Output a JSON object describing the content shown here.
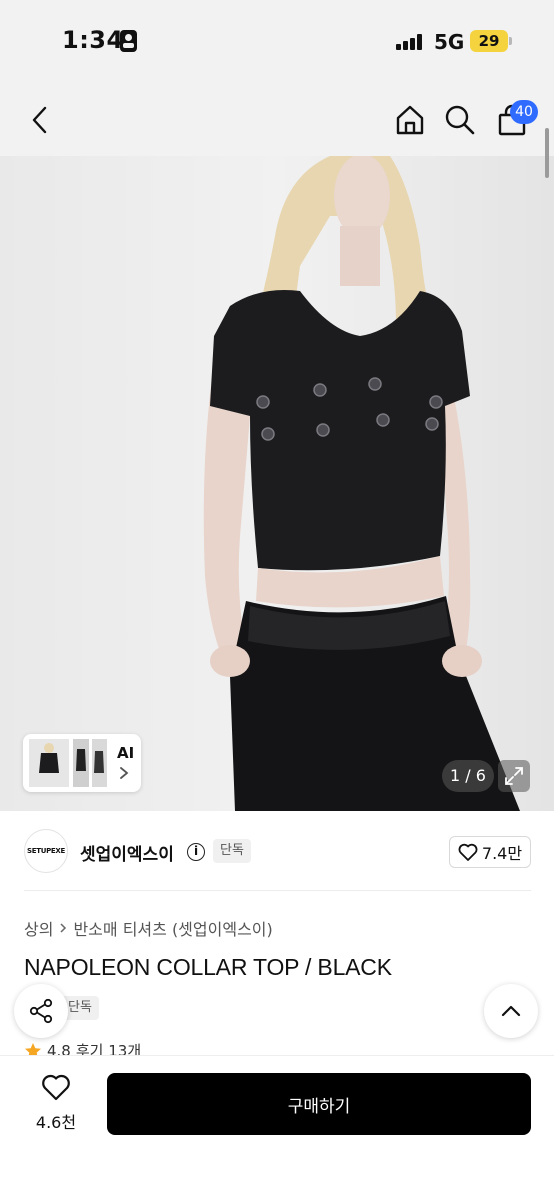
{
  "status_bar": {
    "time": "1:34",
    "network": "5G",
    "battery": "29"
  },
  "header": {
    "back_icon": "chevron-left-icon",
    "home_icon": "home-icon",
    "search_icon": "search-icon",
    "cart_icon": "shopping-bag-icon",
    "cart_badge": "40",
    "badge_color": "#2f6bff"
  },
  "gallery": {
    "thumb_label": "AI",
    "pager": "1 / 6",
    "expand_icon": "expand-icon"
  },
  "brand": {
    "logo_text": "SETUPEXE",
    "name": "셋업이엑스이",
    "info_icon": "info-icon",
    "tag": "단독",
    "likes": "7.4만"
  },
  "breadcrumb": {
    "category": "상의",
    "subcategory": "반소매 티셔츠 (셋업이엑스이)"
  },
  "product": {
    "title": "NAPOLEON COLLAR TOP / BLACK",
    "tag": "단독",
    "rating": "4.8",
    "reviews": "후기 13개"
  },
  "bottom_bar": {
    "wish_count": "4.6천",
    "buy_label": "구매하기"
  }
}
